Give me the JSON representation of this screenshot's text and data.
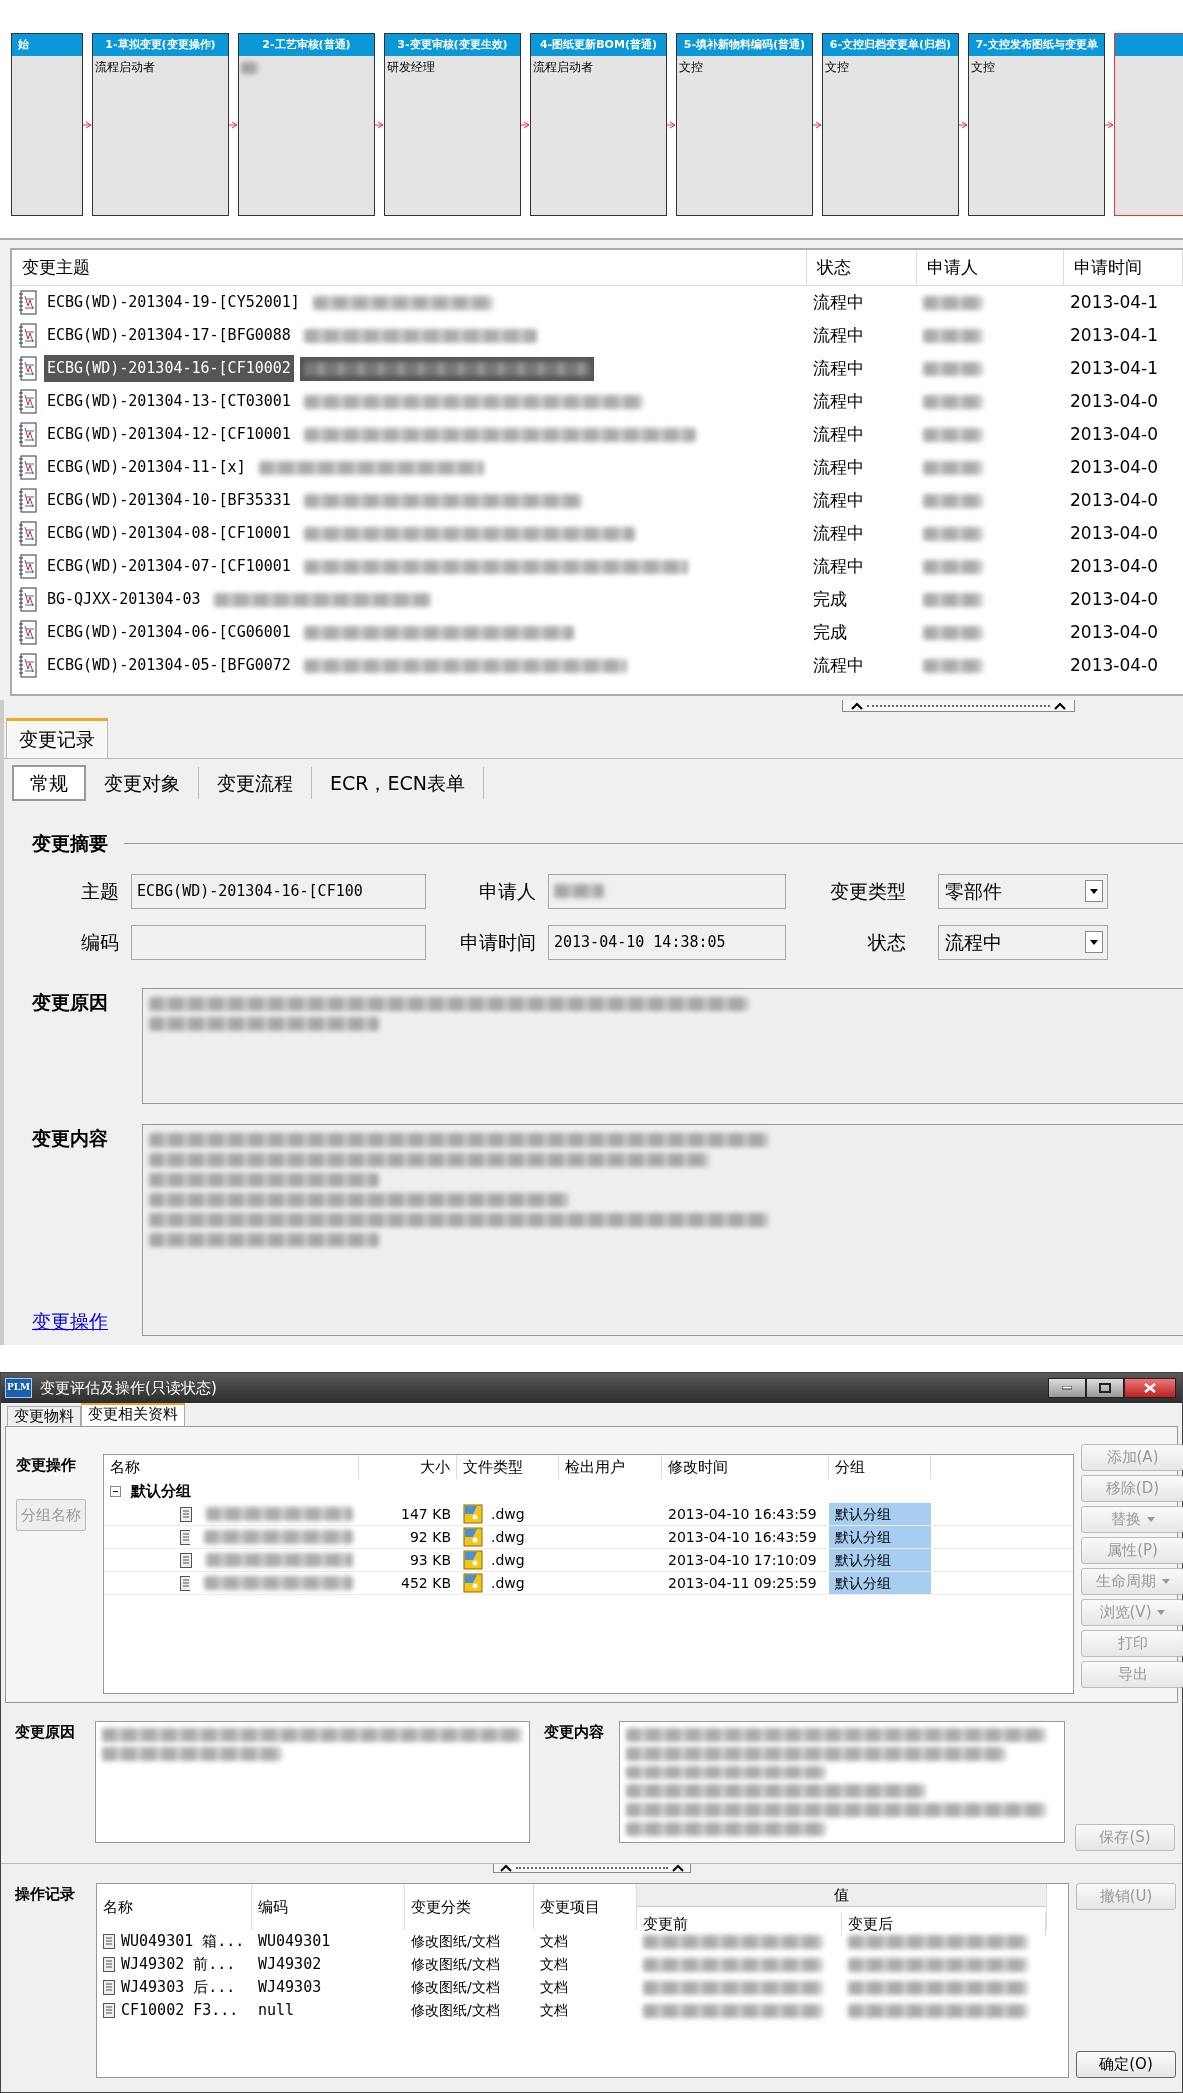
{
  "workflow": {
    "steps": [
      {
        "title": "始",
        "highlighted": false
      },
      {
        "title": "1-草拟变更(变更操作)",
        "assignee": "流程启动者",
        "highlighted": false
      },
      {
        "title": "2-工艺审核(普通)",
        "redacted": true,
        "highlighted": false
      },
      {
        "title": "3-变更审核(变更生效)",
        "assignee": "研发经理",
        "highlighted": false
      },
      {
        "title": "4-图纸更新BOM(普通)",
        "assignee": "流程启动者",
        "highlighted": false
      },
      {
        "title": "5-填补新物料编码(普通)",
        "assignee": "文控",
        "highlighted": false
      },
      {
        "title": "6-文控归档变更单(归档)",
        "assignee": "文控",
        "highlighted": false
      },
      {
        "title": "7-文控发布图纸与变更单",
        "assignee": "文控",
        "highlighted": false
      },
      {
        "highlighted": true
      }
    ]
  },
  "list": {
    "columns": [
      "变更主题",
      "状态",
      "申请人",
      "申请时间"
    ],
    "rows": [
      {
        "subject": "ECBG(WD)-201304-19-[CY52001]",
        "status": "流程中",
        "time": "2013-04-1",
        "selected": false
      },
      {
        "subject": "ECBG(WD)-201304-17-[BFG0088",
        "status": "流程中",
        "time": "2013-04-1",
        "selected": false
      },
      {
        "subject": "ECBG(WD)-201304-16-[CF10002",
        "status": "流程中",
        "time": "2013-04-1",
        "selected": true
      },
      {
        "subject": "ECBG(WD)-201304-13-[CT03001",
        "status": "流程中",
        "time": "2013-04-0",
        "selected": false
      },
      {
        "subject": "ECBG(WD)-201304-12-[CF10001",
        "status": "流程中",
        "time": "2013-04-0",
        "selected": false
      },
      {
        "subject": "ECBG(WD)-201304-11-[x]",
        "status": "流程中",
        "time": "2013-04-0",
        "selected": false
      },
      {
        "subject": "ECBG(WD)-201304-10-[BF35331",
        "status": "流程中",
        "time": "2013-04-0",
        "selected": false
      },
      {
        "subject": "ECBG(WD)-201304-08-[CF10001",
        "status": "流程中",
        "time": "2013-04-0",
        "selected": false
      },
      {
        "subject": "ECBG(WD)-201304-07-[CF10001",
        "status": "流程中",
        "time": "2013-04-0",
        "selected": false
      },
      {
        "subject": "BG-QJXX-201304-03",
        "status": "完成",
        "time": "2013-04-0",
        "selected": false
      },
      {
        "subject": "ECBG(WD)-201304-06-[CG06001",
        "status": "完成",
        "time": "2013-04-0",
        "selected": false
      },
      {
        "subject": "ECBG(WD)-201304-05-[BFG0072",
        "status": "流程中",
        "time": "2013-04-0",
        "selected": false
      }
    ]
  },
  "record": {
    "tab": "变更记录",
    "subtabs": [
      {
        "label": "常规",
        "selected": true
      },
      {
        "label": "变更对象",
        "selected": false
      },
      {
        "label": "变更流程",
        "selected": false
      },
      {
        "label": "ECR，ECN表单",
        "selected": false
      }
    ],
    "section": "变更摘要",
    "subject_label": "主题",
    "subject": "ECBG(WD)-201304-16-[CF100",
    "applicant_label": "申请人",
    "type_label": "变更类型",
    "type": "零部件",
    "code_label": "编码",
    "time_label": "申请时间",
    "time": "2013-04-10 14:38:05",
    "status_label": "状态",
    "status": "流程中",
    "reason_label": "变更原因",
    "content_label": "变更内容",
    "link": "变更操作"
  },
  "dialog": {
    "app_icon": "PLM",
    "title": "变更评估及操作(只读状态)",
    "tabs": [
      {
        "label": "变更物料",
        "selected": false
      },
      {
        "label": "变更相关资料",
        "selected": true
      }
    ],
    "ops_label": "变更操作",
    "group_button": {
      "label": "分组名称",
      "disabled": true
    },
    "files": {
      "columns": [
        "名称",
        "大小",
        "文件类型",
        "检出用户",
        "修改时间",
        "分组"
      ],
      "group": "默认分组",
      "expanded": true,
      "rows": [
        {
          "size": "147 KB",
          "type": ".dwg",
          "time": "2013-04-10 16:43:59",
          "group": "默认分组"
        },
        {
          "size": "92 KB",
          "type": ".dwg",
          "time": "2013-04-10 16:43:59",
          "group": "默认分组"
        },
        {
          "size": "93 KB",
          "type": ".dwg",
          "time": "2013-04-10 17:10:09",
          "group": "默认分组"
        },
        {
          "size": "452 KB",
          "type": ".dwg",
          "time": "2013-04-11 09:25:59",
          "group": "默认分组"
        }
      ]
    },
    "side_buttons": [
      {
        "label": "添加(A)",
        "dropdown": false,
        "disabled": true
      },
      {
        "label": "移除(D)",
        "dropdown": false,
        "disabled": true
      },
      {
        "label": "替换",
        "dropdown": true,
        "disabled": true
      },
      {
        "label": "属性(P)",
        "dropdown": false,
        "disabled": true
      },
      {
        "label": "生命周期",
        "dropdown": true,
        "disabled": true
      },
      {
        "label": "浏览(V)",
        "dropdown": true,
        "disabled": true
      },
      {
        "label": "打印",
        "dropdown": false,
        "disabled": true
      },
      {
        "label": "导出",
        "dropdown": false,
        "disabled": true
      }
    ],
    "reason_label": "变更原因",
    "content_label": "变更内容",
    "save_button": {
      "label": "保存(S)",
      "disabled": true
    },
    "log": {
      "label": "操作记录",
      "columns": [
        "名称",
        "编码",
        "变更分类",
        "变更项目"
      ],
      "value_header": "值",
      "value_columns": [
        "变更前",
        "变更后"
      ],
      "rows": [
        {
          "name": "WU049301 箱...",
          "code": "WU049301",
          "category": "修改图纸/文档",
          "item": "文档"
        },
        {
          "name": "WJ49302 前...",
          "code": "WJ49302",
          "category": "修改图纸/文档",
          "item": "文档"
        },
        {
          "name": "WJ49303 后...",
          "code": "WJ49303",
          "category": "修改图纸/文档",
          "item": "文档"
        },
        {
          "name": "CF10002 F3...",
          "code": "null",
          "category": "修改图纸/文档",
          "item": "文档"
        }
      ]
    },
    "undo_button": {
      "label": "撤销(U)",
      "disabled": true
    },
    "ok_button": {
      "label": "确定(O)",
      "disabled": false
    }
  }
}
